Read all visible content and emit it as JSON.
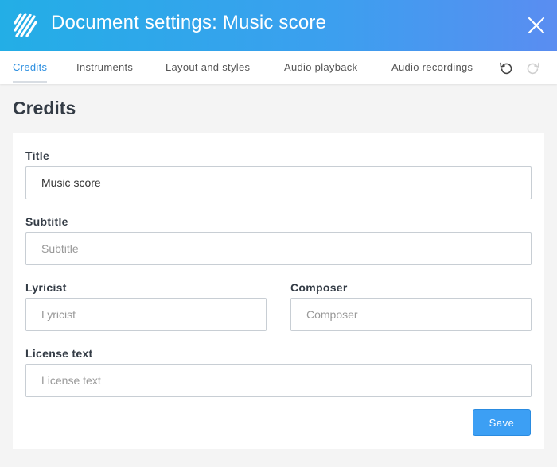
{
  "header": {
    "title": "Document settings: Music score",
    "logo_icon": "app-logo-icon",
    "close_icon": "close-icon"
  },
  "tabs": [
    {
      "label": "Credits",
      "active": true
    },
    {
      "label": "Instruments",
      "active": false
    },
    {
      "label": "Layout and styles",
      "active": false
    },
    {
      "label": "Audio playback",
      "active": false
    },
    {
      "label": "Audio recordings",
      "active": false
    }
  ],
  "toolbar": {
    "undo_icon": "undo-icon",
    "redo_icon": "redo-icon"
  },
  "section": {
    "heading": "Credits"
  },
  "form": {
    "title": {
      "label": "Title",
      "value": "Music score",
      "placeholder": "Title"
    },
    "subtitle": {
      "label": "Subtitle",
      "value": "",
      "placeholder": "Subtitle"
    },
    "lyricist": {
      "label": "Lyricist",
      "value": "",
      "placeholder": "Lyricist"
    },
    "composer": {
      "label": "Composer",
      "value": "",
      "placeholder": "Composer"
    },
    "license": {
      "label": "License text",
      "value": "",
      "placeholder": "License text"
    },
    "save_label": "Save"
  },
  "colors": {
    "header_gradient_start": "#23aee6",
    "header_gradient_end": "#5a8df1",
    "active_tab": "#2c8fe0",
    "save_button": "#3c9ff4"
  }
}
